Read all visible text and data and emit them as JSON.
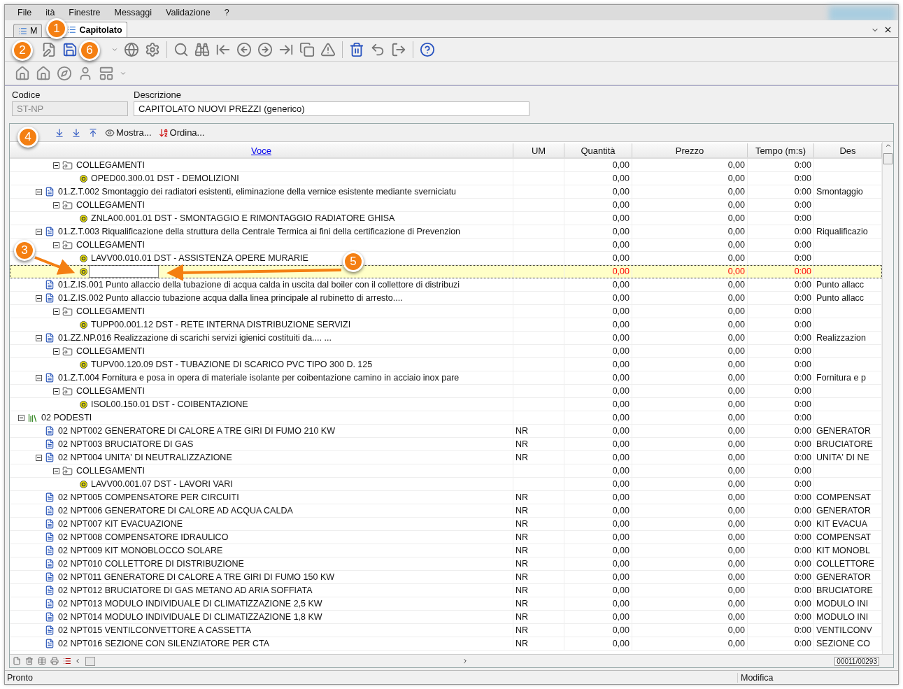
{
  "menu": [
    {
      "label": "File"
    },
    {
      "label": "ità"
    },
    {
      "label": "Finestre"
    },
    {
      "label": "Messaggi"
    },
    {
      "label": "Validazione"
    },
    {
      "label": "?"
    }
  ],
  "tabs": [
    {
      "label": "M",
      "selected": false
    },
    {
      "label": "Capitolato",
      "selected": true
    }
  ],
  "form": {
    "code_label": "Codice",
    "code_value": "ST-NP",
    "code_disabled": true,
    "description_label": "Descrizione",
    "description_value": "CAPITOLATO NUOVI PREZZI (generico)"
  },
  "grid_toolbar": {
    "show_label": "Mostra...",
    "sort_label": "Ordina..."
  },
  "columns": [
    {
      "label": "Voce",
      "link": true
    },
    {
      "label": "UM",
      "link": false
    },
    {
      "label": "Quantità",
      "link": false
    },
    {
      "label": "Prezzo",
      "link": false
    },
    {
      "label": "Tempo (m:s)",
      "link": false
    },
    {
      "label": "Des",
      "link": false
    }
  ],
  "tree": [
    {
      "kind": "continuation",
      "children": [
        {
          "kind": "continuation",
          "children": [
            {
              "kind": "folder",
              "label": "COLLEGAMENTI",
              "expanded": true,
              "selected": false,
              "quantity": "0,00",
              "price": "0,00",
              "time": "0:00",
              "children": [
                {
                  "kind": "resource",
                  "label": "OPED00.300.01 DST - DEMOLIZIONI",
                  "selected": false,
                  "quantity": "0,00",
                  "price": "0,00",
                  "time": "0:00"
                }
              ]
            }
          ]
        },
        {
          "kind": "item",
          "label": "01.Z.T.002 Smontaggio dei radiatori esistenti, eliminazione della  vernice esistente mediante sverniciatu",
          "description": "Smontaggio",
          "expanded": true,
          "selected": false,
          "quantity": "0,00",
          "price": "0,00",
          "time": "0:00",
          "children": [
            {
              "kind": "folder",
              "label": "COLLEGAMENTI",
              "expanded": true,
              "selected": false,
              "quantity": "0,00",
              "price": "0,00",
              "time": "0:00",
              "children": [
                {
                  "kind": "resource",
                  "label": "ZNLA00.001.01 DST - SMONTAGGIO E RIMONTAGGIO RADIATORE GHISA",
                  "selected": false,
                  "quantity": "0,00",
                  "price": "0,00",
                  "time": "0:00"
                }
              ]
            }
          ]
        },
        {
          "kind": "item",
          "label": "01.Z.T.003 Riqualificazione della struttura della Centrale Termica ai fini della certificazione di Prevenzion",
          "description": "Riqualificazio",
          "expanded": true,
          "selected": false,
          "quantity": "0,00",
          "price": "0,00",
          "time": "0:00",
          "children": [
            {
              "kind": "folder",
              "label": "COLLEGAMENTI",
              "expanded": true,
              "selected": false,
              "quantity": "0,00",
              "price": "0,00",
              "time": "0:00",
              "children": [
                {
                  "kind": "resource",
                  "label": "LAVV00.010.01 DST - ASSISTENZA OPERE MURARIE",
                  "selected": false,
                  "quantity": "0,00",
                  "price": "0,00",
                  "time": "0:00"
                },
                {
                  "kind": "new",
                  "selected": true,
                  "quantity": "0,00",
                  "price": "0,00",
                  "time": "0:00"
                }
              ]
            }
          ]
        },
        {
          "kind": "item",
          "label": "01.Z.IS.001 Punto allaccio della tubazione di acqua calda in uscita dal boiler con il collettore di distribuzi",
          "description": "Punto allacc",
          "selected": false,
          "quantity": "0,00",
          "price": "0,00",
          "time": "0:00"
        },
        {
          "kind": "item",
          "label": "01.Z.IS.002 Punto allaccio tubazione acqua dalla linea principale al rubinetto di arresto....",
          "description": "Punto allacc",
          "expanded": true,
          "selected": false,
          "quantity": "0,00",
          "price": "0,00",
          "time": "0:00",
          "children": [
            {
              "kind": "folder",
              "label": "COLLEGAMENTI",
              "expanded": true,
              "selected": false,
              "quantity": "0,00",
              "price": "0,00",
              "time": "0:00",
              "children": [
                {
                  "kind": "resource",
                  "label": "TUPP00.001.12 DST - RETE INTERNA DISTRIBUZIONE SERVIZI",
                  "selected": false,
                  "quantity": "0,00",
                  "price": "0,00",
                  "time": "0:00"
                }
              ]
            }
          ]
        },
        {
          "kind": "item",
          "label": "01.ZZ.NP.016 Realizzazione di scarichi servizi igienici costituiti da.... ...",
          "description": "Realizzazion",
          "expanded": true,
          "selected": false,
          "quantity": "0,00",
          "price": "0,00",
          "time": "0:00",
          "children": [
            {
              "kind": "folder",
              "label": "COLLEGAMENTI",
              "expanded": true,
              "selected": false,
              "quantity": "0,00",
              "price": "0,00",
              "time": "0:00",
              "children": [
                {
                  "kind": "resource",
                  "label": "TUPV00.120.09 DST - TUBAZIONE DI SCARICO PVC TIPO 300 D. 125",
                  "selected": false,
                  "quantity": "0,00",
                  "price": "0,00",
                  "time": "0:00"
                }
              ]
            }
          ]
        },
        {
          "kind": "item",
          "label": "01.Z.T.004 Fornitura e posa in opera di materiale isolante per coibentazione camino in acciaio inox pare",
          "description": "Fornitura e p",
          "expanded": true,
          "selected": false,
          "quantity": "0,00",
          "price": "0,00",
          "time": "0:00",
          "children": [
            {
              "kind": "folder",
              "label": "COLLEGAMENTI",
              "expanded": true,
              "selected": false,
              "quantity": "0,00",
              "price": "0,00",
              "time": "0:00",
              "children": [
                {
                  "kind": "resource",
                  "label": "ISOL00.150.01 DST - COIBENTAZIONE",
                  "selected": false,
                  "quantity": "0,00",
                  "price": "0,00",
                  "time": "0:00"
                }
              ]
            }
          ]
        }
      ]
    },
    {
      "kind": "chapter",
      "label": "02 PODESTI",
      "expanded": true,
      "selected": false,
      "quantity": "0,00",
      "price": "0,00",
      "time": "0:00",
      "children": [
        {
          "kind": "item",
          "label": "02 NPT002 GENERATORE DI CALORE A TRE GIRI DI FUMO 210 KW",
          "um": "NR",
          "description": "GENERATOR",
          "selected": false,
          "quantity": "0,00",
          "price": "0,00",
          "time": "0:00"
        },
        {
          "kind": "item",
          "label": "02 NPT003 BRUCIATORE DI GAS",
          "um": "NR",
          "description": "BRUCIATORE",
          "selected": false,
          "quantity": "0,00",
          "price": "0,00",
          "time": "0:00"
        },
        {
          "kind": "item",
          "label": "02 NPT004 UNITA' DI NEUTRALIZZAZIONE",
          "um": "NR",
          "description": "UNITA' DI NE",
          "expanded": true,
          "selected": false,
          "quantity": "0,00",
          "price": "0,00",
          "time": "0:00",
          "children": [
            {
              "kind": "folder",
              "label": "COLLEGAMENTI",
              "expanded": true,
              "selected": false,
              "quantity": "0,00",
              "price": "0,00",
              "time": "0:00",
              "children": [
                {
                  "kind": "resource",
                  "label": "LAVV00.001.07 DST - LAVORI VARI",
                  "selected": false,
                  "quantity": "0,00",
                  "price": "0,00",
                  "time": "0:00"
                }
              ]
            }
          ]
        },
        {
          "kind": "item",
          "label": "02 NPT005 COMPENSATORE PER CIRCUITI",
          "um": "NR",
          "description": "COMPENSAT",
          "selected": false,
          "quantity": "0,00",
          "price": "0,00",
          "time": "0:00"
        },
        {
          "kind": "item",
          "label": "02 NPT006 GENERATORE DI CALORE AD ACQUA CALDA",
          "um": "NR",
          "description": "GENERATOR",
          "selected": false,
          "quantity": "0,00",
          "price": "0,00",
          "time": "0:00"
        },
        {
          "kind": "item",
          "label": "02 NPT007 KIT EVACUAZIONE",
          "um": "NR",
          "description": "KIT EVACUA",
          "selected": false,
          "quantity": "0,00",
          "price": "0,00",
          "time": "0:00"
        },
        {
          "kind": "item",
          "label": "02 NPT008 COMPENSATORE IDRAULICO",
          "um": "NR",
          "description": "COMPENSAT",
          "selected": false,
          "quantity": "0,00",
          "price": "0,00",
          "time": "0:00"
        },
        {
          "kind": "item",
          "label": "02 NPT009 KIT MONOBLOCCO SOLARE",
          "um": "NR",
          "description": "KIT MONOBL",
          "selected": false,
          "quantity": "0,00",
          "price": "0,00",
          "time": "0:00"
        },
        {
          "kind": "item",
          "label": "02 NPT010 COLLETTORE DI DISTRIBUZIONE",
          "um": "NR",
          "description": "COLLETTORE",
          "selected": false,
          "quantity": "0,00",
          "price": "0,00",
          "time": "0:00"
        },
        {
          "kind": "item",
          "label": "02 NPT011 GENERATORE DI CALORE A TRE GIRI DI FUMO 150 KW",
          "um": "NR",
          "description": "GENERATOR",
          "selected": false,
          "quantity": "0,00",
          "price": "0,00",
          "time": "0:00"
        },
        {
          "kind": "item",
          "label": "02 NPT012 BRUCIATORE DI GAS METANO AD ARIA SOFFIATA",
          "um": "NR",
          "description": "BRUCIATORE",
          "selected": false,
          "quantity": "0,00",
          "price": "0,00",
          "time": "0:00"
        },
        {
          "kind": "item",
          "label": "02 NPT013 MODULO INDIVIDUALE DI CLIMATIZZAZIONE 2,5 KW",
          "um": "NR",
          "description": "MODULO INI",
          "selected": false,
          "quantity": "0,00",
          "price": "0,00",
          "time": "0:00"
        },
        {
          "kind": "item",
          "label": "02 NPT014 MODULO INDIVIDUALE DI CLIMATIZZAZIONE 1,8 KW",
          "um": "NR",
          "description": "MODULO INI",
          "selected": false,
          "quantity": "0,00",
          "price": "0,00",
          "time": "0:00"
        },
        {
          "kind": "item",
          "label": "02 NPT015 VENTILCONVETTORE A CASSETTA",
          "um": "NR",
          "description": "VENTILCONV",
          "selected": false,
          "quantity": "0,00",
          "price": "0,00",
          "time": "0:00"
        },
        {
          "kind": "item",
          "label": "02 NPT016 SEZIONE CON SILENZIATORE PER CTA",
          "um": "NR",
          "description": "SEZIONE CO",
          "selected": false,
          "quantity": "0,00",
          "price": "0,00",
          "time": "0:00"
        }
      ]
    }
  ],
  "record_counter": "00011/00293",
  "status_bar": {
    "message": "Pronto",
    "mode": "Modifica"
  },
  "callouts": [
    {
      "label": "1"
    },
    {
      "label": "2"
    },
    {
      "label": "6"
    },
    {
      "label": "4"
    },
    {
      "label": "3"
    },
    {
      "label": "5"
    }
  ]
}
